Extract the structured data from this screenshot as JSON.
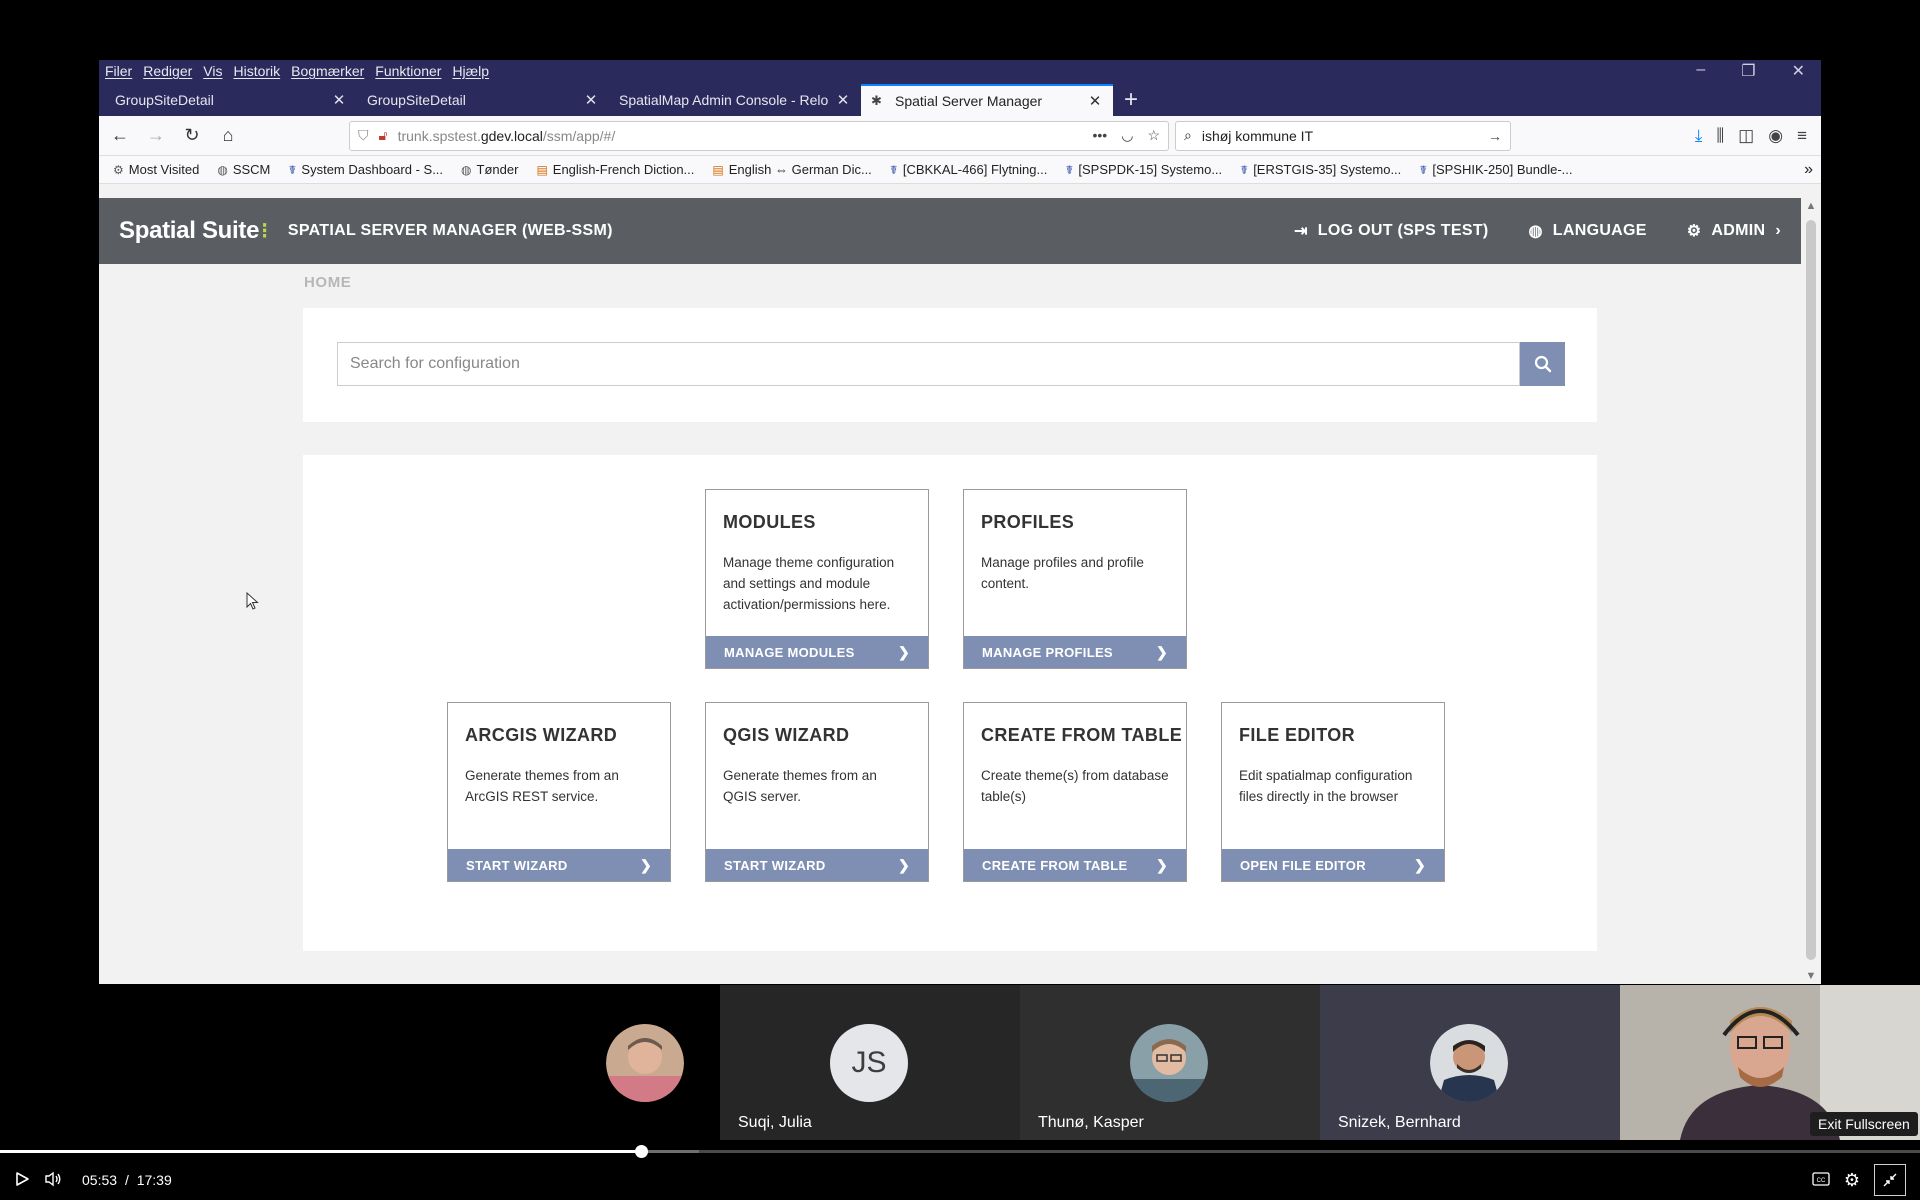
{
  "browser": {
    "menu": [
      "Filer",
      "Rediger",
      "Vis",
      "Historik",
      "Bogmærker",
      "Funktioner",
      "Hjælp"
    ],
    "tabs": [
      {
        "title": "GroupSiteDetail",
        "active": false
      },
      {
        "title": "GroupSiteDetail",
        "active": false
      },
      {
        "title": "SpatialMap Admin Console - Relo",
        "active": false
      },
      {
        "title": "Spatial Server Manager",
        "active": true
      }
    ],
    "url": {
      "prefix": "trunk.spstest.",
      "host": "gdev.local",
      "path": "/ssm/app/#/"
    },
    "search_value": "ishøj kommune IT",
    "bookmarks": [
      {
        "label": "Most Visited",
        "icon": "gear-icon"
      },
      {
        "label": "SSCM",
        "icon": "globe-icon"
      },
      {
        "label": "System Dashboard - S...",
        "icon": "jira-icon"
      },
      {
        "label": "Tønder",
        "icon": "globe-icon"
      },
      {
        "label": "English-French Diction...",
        "icon": "dictionary-icon"
      },
      {
        "label": "English ⇔ German Dic...",
        "icon": "dictionary-icon"
      },
      {
        "label": "[CBKKAL-466] Flytning...",
        "icon": "jira-icon"
      },
      {
        "label": "[SPSPDK-15] Systemo...",
        "icon": "jira-icon"
      },
      {
        "label": "[ERSTGIS-35] Systemo...",
        "icon": "jira-icon"
      },
      {
        "label": "[SPSHIK-250] Bundle-...",
        "icon": "jira-icon"
      }
    ]
  },
  "app": {
    "brand": "Spatial Suite",
    "title": "SPATIAL SERVER MANAGER (WEB-SSM)",
    "actions": {
      "logout": "LOG OUT (SPS TEST)",
      "language": "LANGUAGE",
      "admin": "ADMIN"
    },
    "breadcrumb": "HOME",
    "search_placeholder": "Search for configuration",
    "cards": [
      {
        "title": "MODULES",
        "desc": "Manage theme configuration and settings and module activation/permissions here.",
        "button": "MANAGE MODULES"
      },
      {
        "title": "PROFILES",
        "desc": "Manage profiles and profile content.",
        "button": "MANAGE PROFILES"
      },
      {
        "title": "ARCGIS WIZARD",
        "desc": "Generate themes from an ArcGIS REST service.",
        "button": "START WIZARD"
      },
      {
        "title": "QGIS WIZARD",
        "desc": "Generate themes from an QGIS server.",
        "button": "START WIZARD"
      },
      {
        "title": "CREATE FROM TABLE",
        "desc": "Create theme(s) from database table(s)",
        "button": "CREATE FROM TABLE"
      },
      {
        "title": "FILE EDITOR",
        "desc": "Edit spatialmap configuration files directly in the browser",
        "button": "OPEN FILE EDITOR"
      }
    ],
    "accent_color": "#7f8fb4",
    "header_color": "#5a5e63"
  },
  "meeting": {
    "participants": [
      {
        "name": "",
        "avatar": "photo"
      },
      {
        "name": "Suqi, Julia",
        "avatar": "JS"
      },
      {
        "name": "Thunø, Kasper",
        "avatar": "photo"
      },
      {
        "name": "Snizek, Bernhard",
        "avatar": "photo"
      }
    ]
  },
  "player": {
    "current_time": "05:53",
    "separator": "/",
    "duration": "17:39",
    "played_fraction": 0.334,
    "buffered_fraction": 0.364,
    "tooltip": "Exit Fullscreen"
  }
}
